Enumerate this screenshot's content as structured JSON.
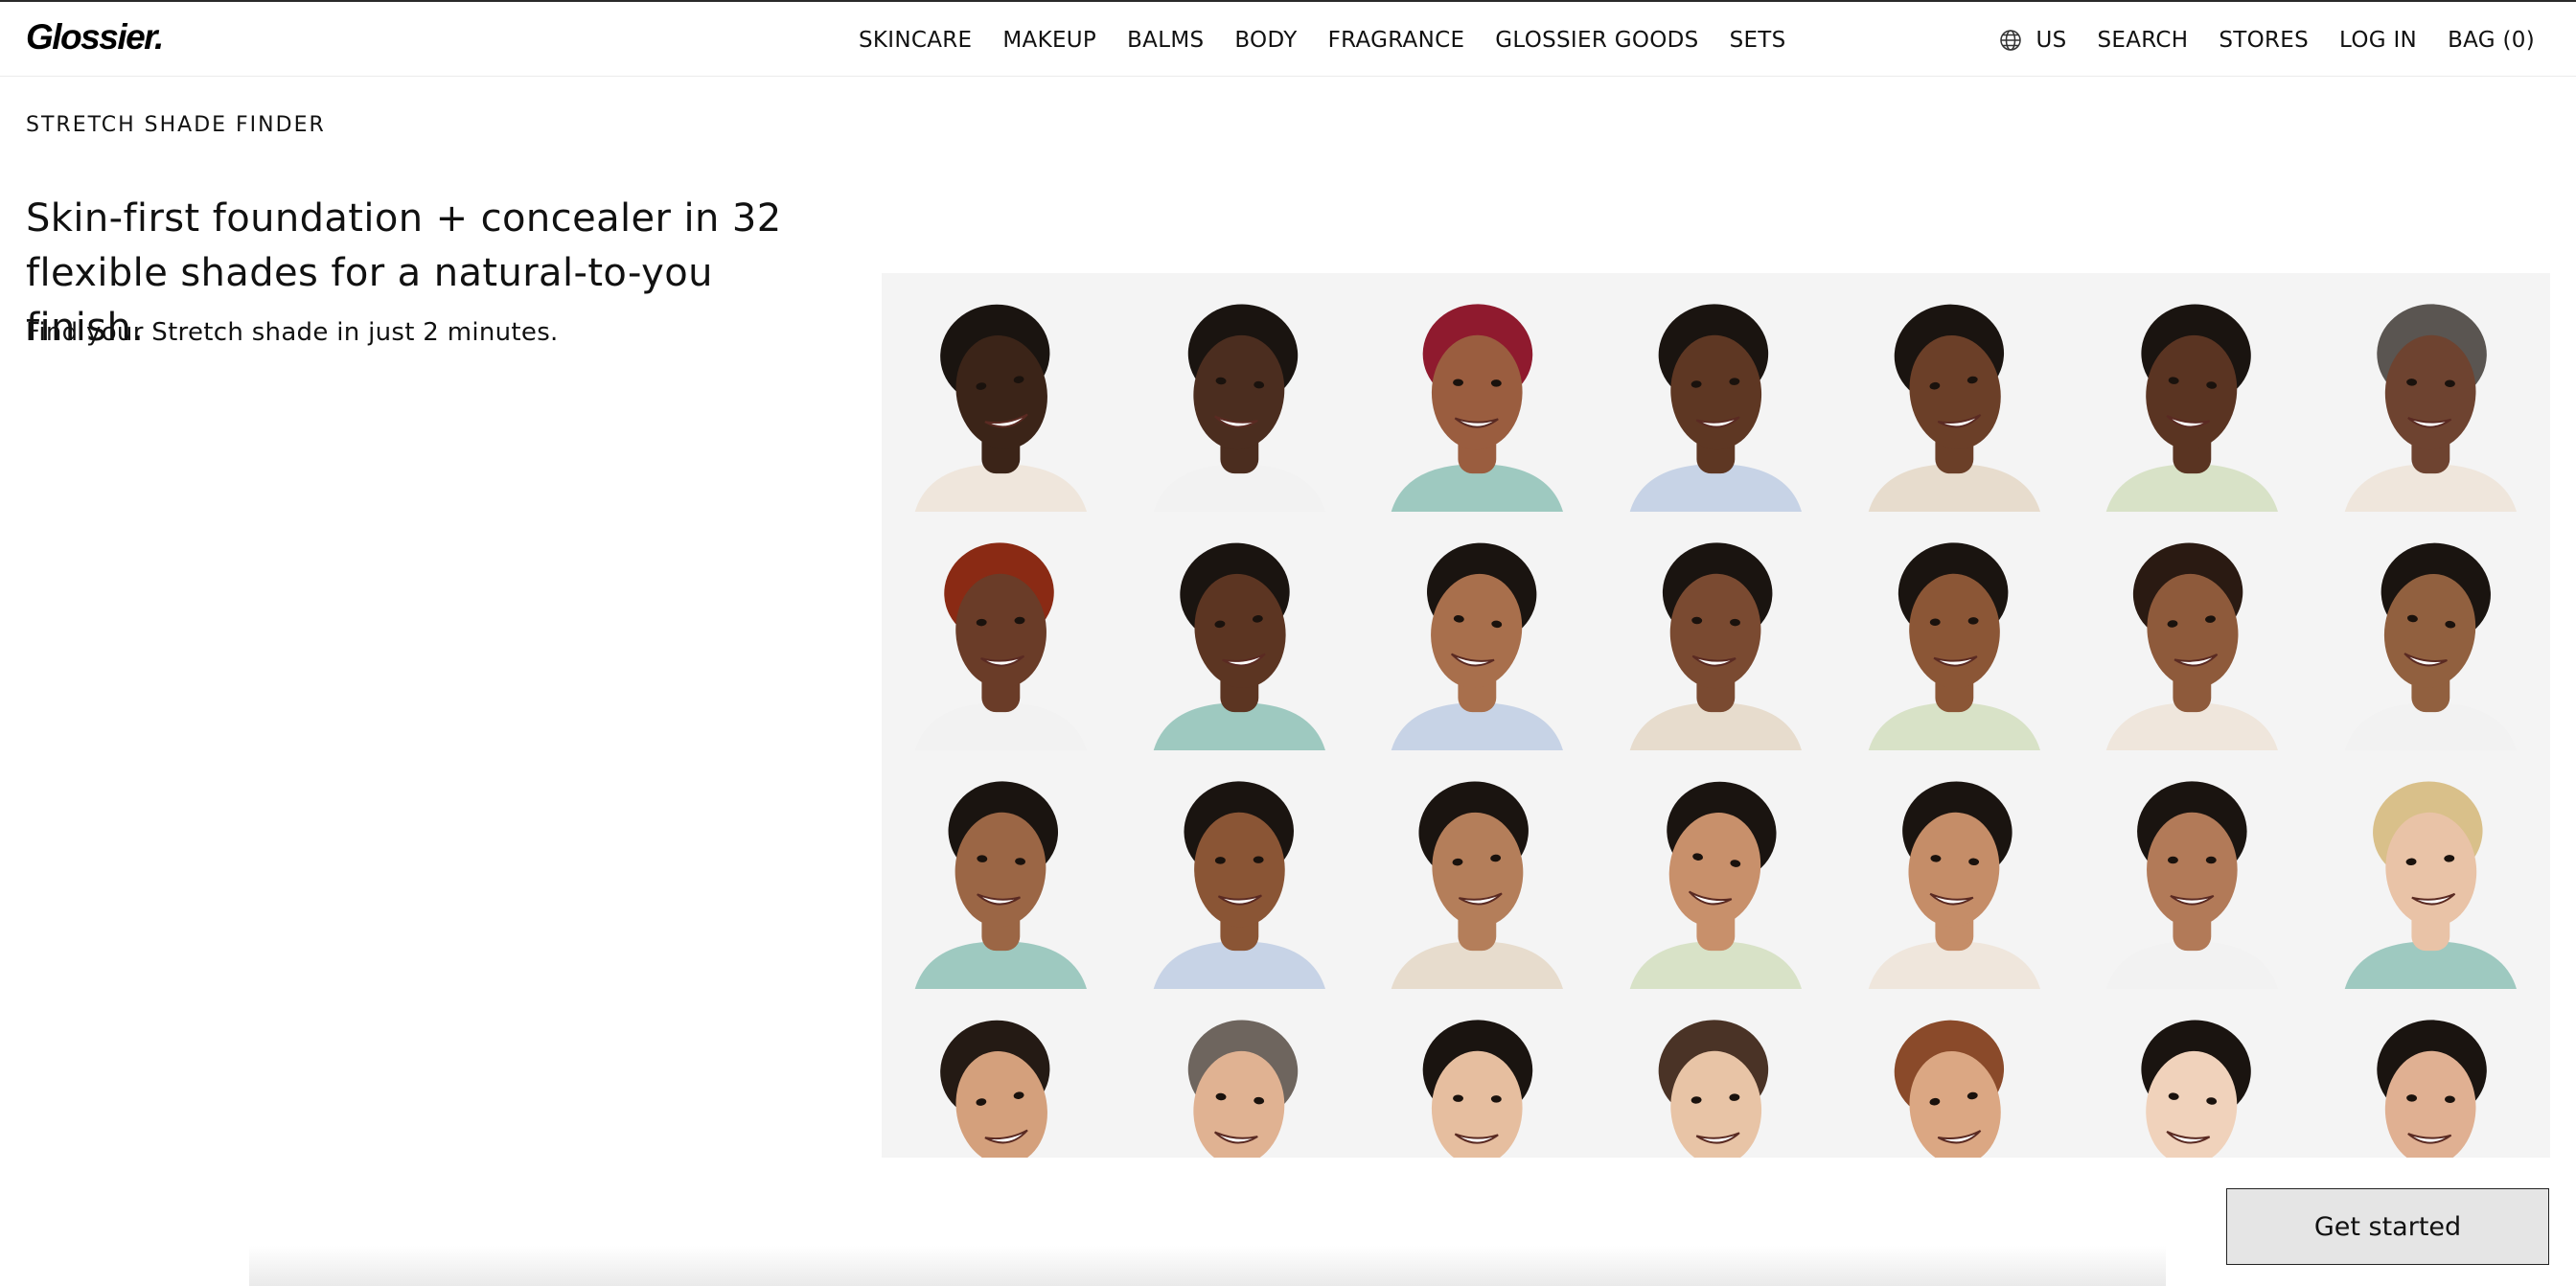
{
  "header": {
    "logo": "Glossier.",
    "nav": [
      "SKINCARE",
      "MAKEUP",
      "BALMS",
      "BODY",
      "FRAGRANCE",
      "GLOSSIER GOODS",
      "SETS"
    ],
    "locale": "US",
    "utility": {
      "search": "SEARCH",
      "stores": "STORES",
      "login": "LOG IN",
      "bag": "BAG (0)"
    }
  },
  "hero": {
    "eyebrow": "STRETCH SHADE FINDER",
    "headline": "Skin-first foundation + concealer in 32 flexible shades for a natural-to-you finish.",
    "subhead": "Find your Stretch shade in just 2 minutes."
  },
  "grid": {
    "skin_tones": [
      "#3b2418",
      "#4b2d1f",
      "#9a5d3f",
      "#5e3723",
      "#6b3f28",
      "#5a3422",
      "#6e4330",
      "#6a3c28",
      "#5c3522",
      "#a86f4c",
      "#7a4a31",
      "#8b5636",
      "#8e5a3b",
      "#91603f",
      "#9b6645",
      "#8a5535",
      "#b47e5a",
      "#c8906b",
      "#c58d68",
      "#b27a58",
      "#e9c3a7",
      "#d4a07c",
      "#e0b292",
      "#e6be9f",
      "#e8c4a6",
      "#dba783",
      "#f0d2bb",
      "#e0b092"
    ],
    "hair_colors": [
      "#1a1410",
      "#1a1410",
      "#8f1a2e",
      "#1a1410",
      "#1a1410",
      "#1a1410",
      "#5a5551",
      "#8a2a14",
      "#1a1410",
      "#1a1410",
      "#1a1410",
      "#1a1410",
      "#2a1a12",
      "#1a1410",
      "#1a1410",
      "#1a1410",
      "#1a1410",
      "#1a1410",
      "#1a1410",
      "#1a1410",
      "#d9c08a",
      "#241a14",
      "#6e655e",
      "#1a1410",
      "#4a3326",
      "#8a4a2a",
      "#1a1410",
      "#1a1410"
    ]
  },
  "cta": {
    "label": "Get started"
  }
}
